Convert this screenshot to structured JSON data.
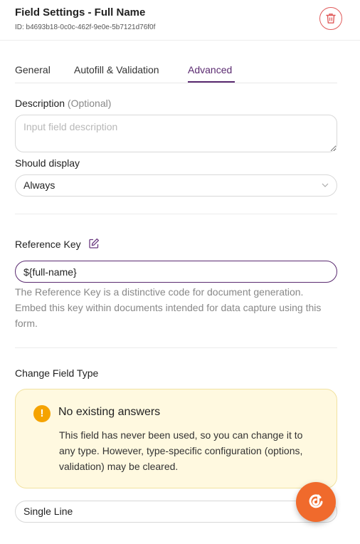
{
  "header": {
    "title": "Field Settings - Full Name",
    "field_id": "ID: b4693b18-0c0c-462f-9e0e-5b7121d76f0f"
  },
  "tabs": [
    {
      "label": "General",
      "active": false
    },
    {
      "label": "Autofill & Validation",
      "active": false
    },
    {
      "label": "Advanced",
      "active": true
    }
  ],
  "description": {
    "label": "Description",
    "optional": "(Optional)",
    "placeholder": "Input field description",
    "value": ""
  },
  "should_display": {
    "label": "Should display",
    "value": "Always"
  },
  "reference_key": {
    "label": "Reference Key",
    "value": "${full-name}",
    "help": "The Reference Key is a distinctive code for document generation. Embed this key within documents intended for data capture using this form."
  },
  "change_field_type": {
    "label": "Change Field Type",
    "notice_title": "No existing answers",
    "notice_body": "This field has never been used, so you can change it to any type. However, type-specific configuration (options, validation) may be cleared.",
    "value": "Single Line"
  },
  "colors": {
    "accent": "#5a2a70",
    "danger": "#e05a5a",
    "warning": "#f5a300",
    "fab": "#f06a2c"
  },
  "icons": {
    "delete": "trash-icon",
    "edit": "pencil-square-icon",
    "warning": "exclamation-circle-icon",
    "chat": "chat-bubble-icon"
  }
}
